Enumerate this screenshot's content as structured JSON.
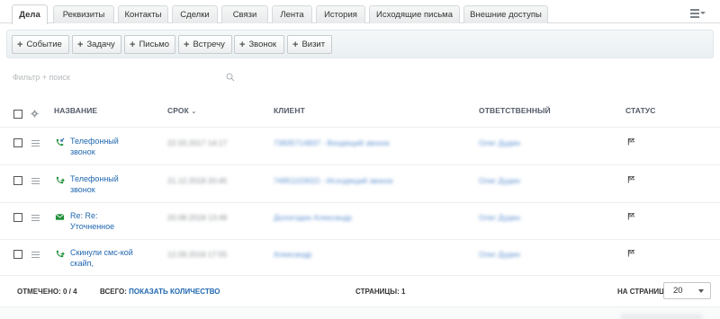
{
  "tabs": [
    {
      "label": "Дела",
      "active": true
    },
    {
      "label": "Реквизиты"
    },
    {
      "label": "Контакты"
    },
    {
      "label": "Сделки"
    },
    {
      "label": "Связи"
    },
    {
      "label": "Лента"
    },
    {
      "label": "История"
    },
    {
      "label": "Исходящие письма"
    },
    {
      "label": "Внешние доступы"
    }
  ],
  "toolbar": {
    "buttons": [
      "Событие",
      "Задачу",
      "Письмо",
      "Встречу",
      "Звонок",
      "Визит"
    ]
  },
  "filter": {
    "placeholder": "Фильтр + поиск"
  },
  "table": {
    "columns": {
      "title": "НАЗВАНИЕ",
      "deadline": "СРОК",
      "client": "КЛИЕНТ",
      "responsible": "ОТВЕТСТВЕННЫЙ",
      "status": "СТАТУС"
    },
    "rows": [
      {
        "icon": "incoming-call-icon",
        "title": "Телефонный звонок",
        "deadline": "22.03.2017 14:17",
        "client": "73835714837 - Входящий звонок",
        "responsible": "Олег Дудин"
      },
      {
        "icon": "outgoing-call-icon",
        "title": "Телефонный звонок",
        "deadline": "21.12.2018 20:45",
        "client": "74951103022 - Исходящий звонок",
        "responsible": "Олег Дудин"
      },
      {
        "icon": "email-icon",
        "title": "Re: Re: Уточненное",
        "deadline": "20.08.2018 13:48",
        "client": "Дологодин Александр",
        "responsible": "Олег Дудин"
      },
      {
        "icon": "outgoing-call-icon",
        "title": "Скинули смс-кой скайп,",
        "deadline": "12.09.2018 17:55",
        "client": "Александр",
        "responsible": "Олег Дудин"
      }
    ]
  },
  "footer": {
    "selected_label": "ОТМЕЧЕНО:",
    "selected_value": "0 / 4",
    "total_label": "ВСЕГО:",
    "total_link": "ПОКАЗАТЬ КОЛИЧЕСТВО",
    "pages_label": "СТРАНИЦЫ:",
    "pages_value": "1",
    "per_page_label": "НА СТРАНИЦЕ:",
    "per_page_value": "20"
  },
  "colors": {
    "link": "#2067b0",
    "call_icon": "#1f8f3a",
    "header_text": "#535c69"
  }
}
